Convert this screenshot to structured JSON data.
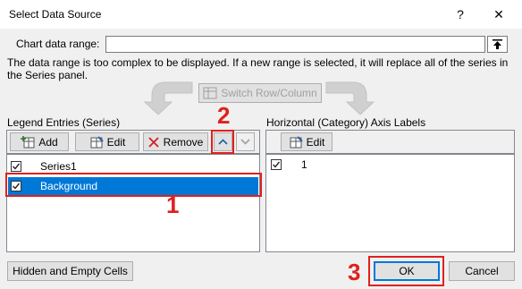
{
  "window": {
    "title": "Select Data Source",
    "help": "?",
    "close": "✕"
  },
  "range": {
    "label": "Chart data range:",
    "value": ""
  },
  "message": "The data range is too complex to be displayed. If a new range is selected, it will replace all of the series in the Series panel.",
  "switch_label": "Switch Row/Column",
  "legend": {
    "heading": "Legend Entries (Series)",
    "add": "Add",
    "edit": "Edit",
    "remove": "Remove",
    "items": [
      {
        "label": "Series1",
        "checked": true,
        "selected": false
      },
      {
        "label": "Background",
        "checked": true,
        "selected": true
      }
    ]
  },
  "axis": {
    "heading": "Horizontal (Category) Axis Labels",
    "edit": "Edit",
    "items": [
      {
        "label": "1",
        "checked": true
      }
    ]
  },
  "hidden_cells": "Hidden and Empty Cells",
  "ok": "OK",
  "cancel": "Cancel",
  "annotations": {
    "n1": "1",
    "n2": "2",
    "n3": "3"
  },
  "colors": {
    "accent": "#0078d7",
    "annotation": "#e0201e"
  }
}
